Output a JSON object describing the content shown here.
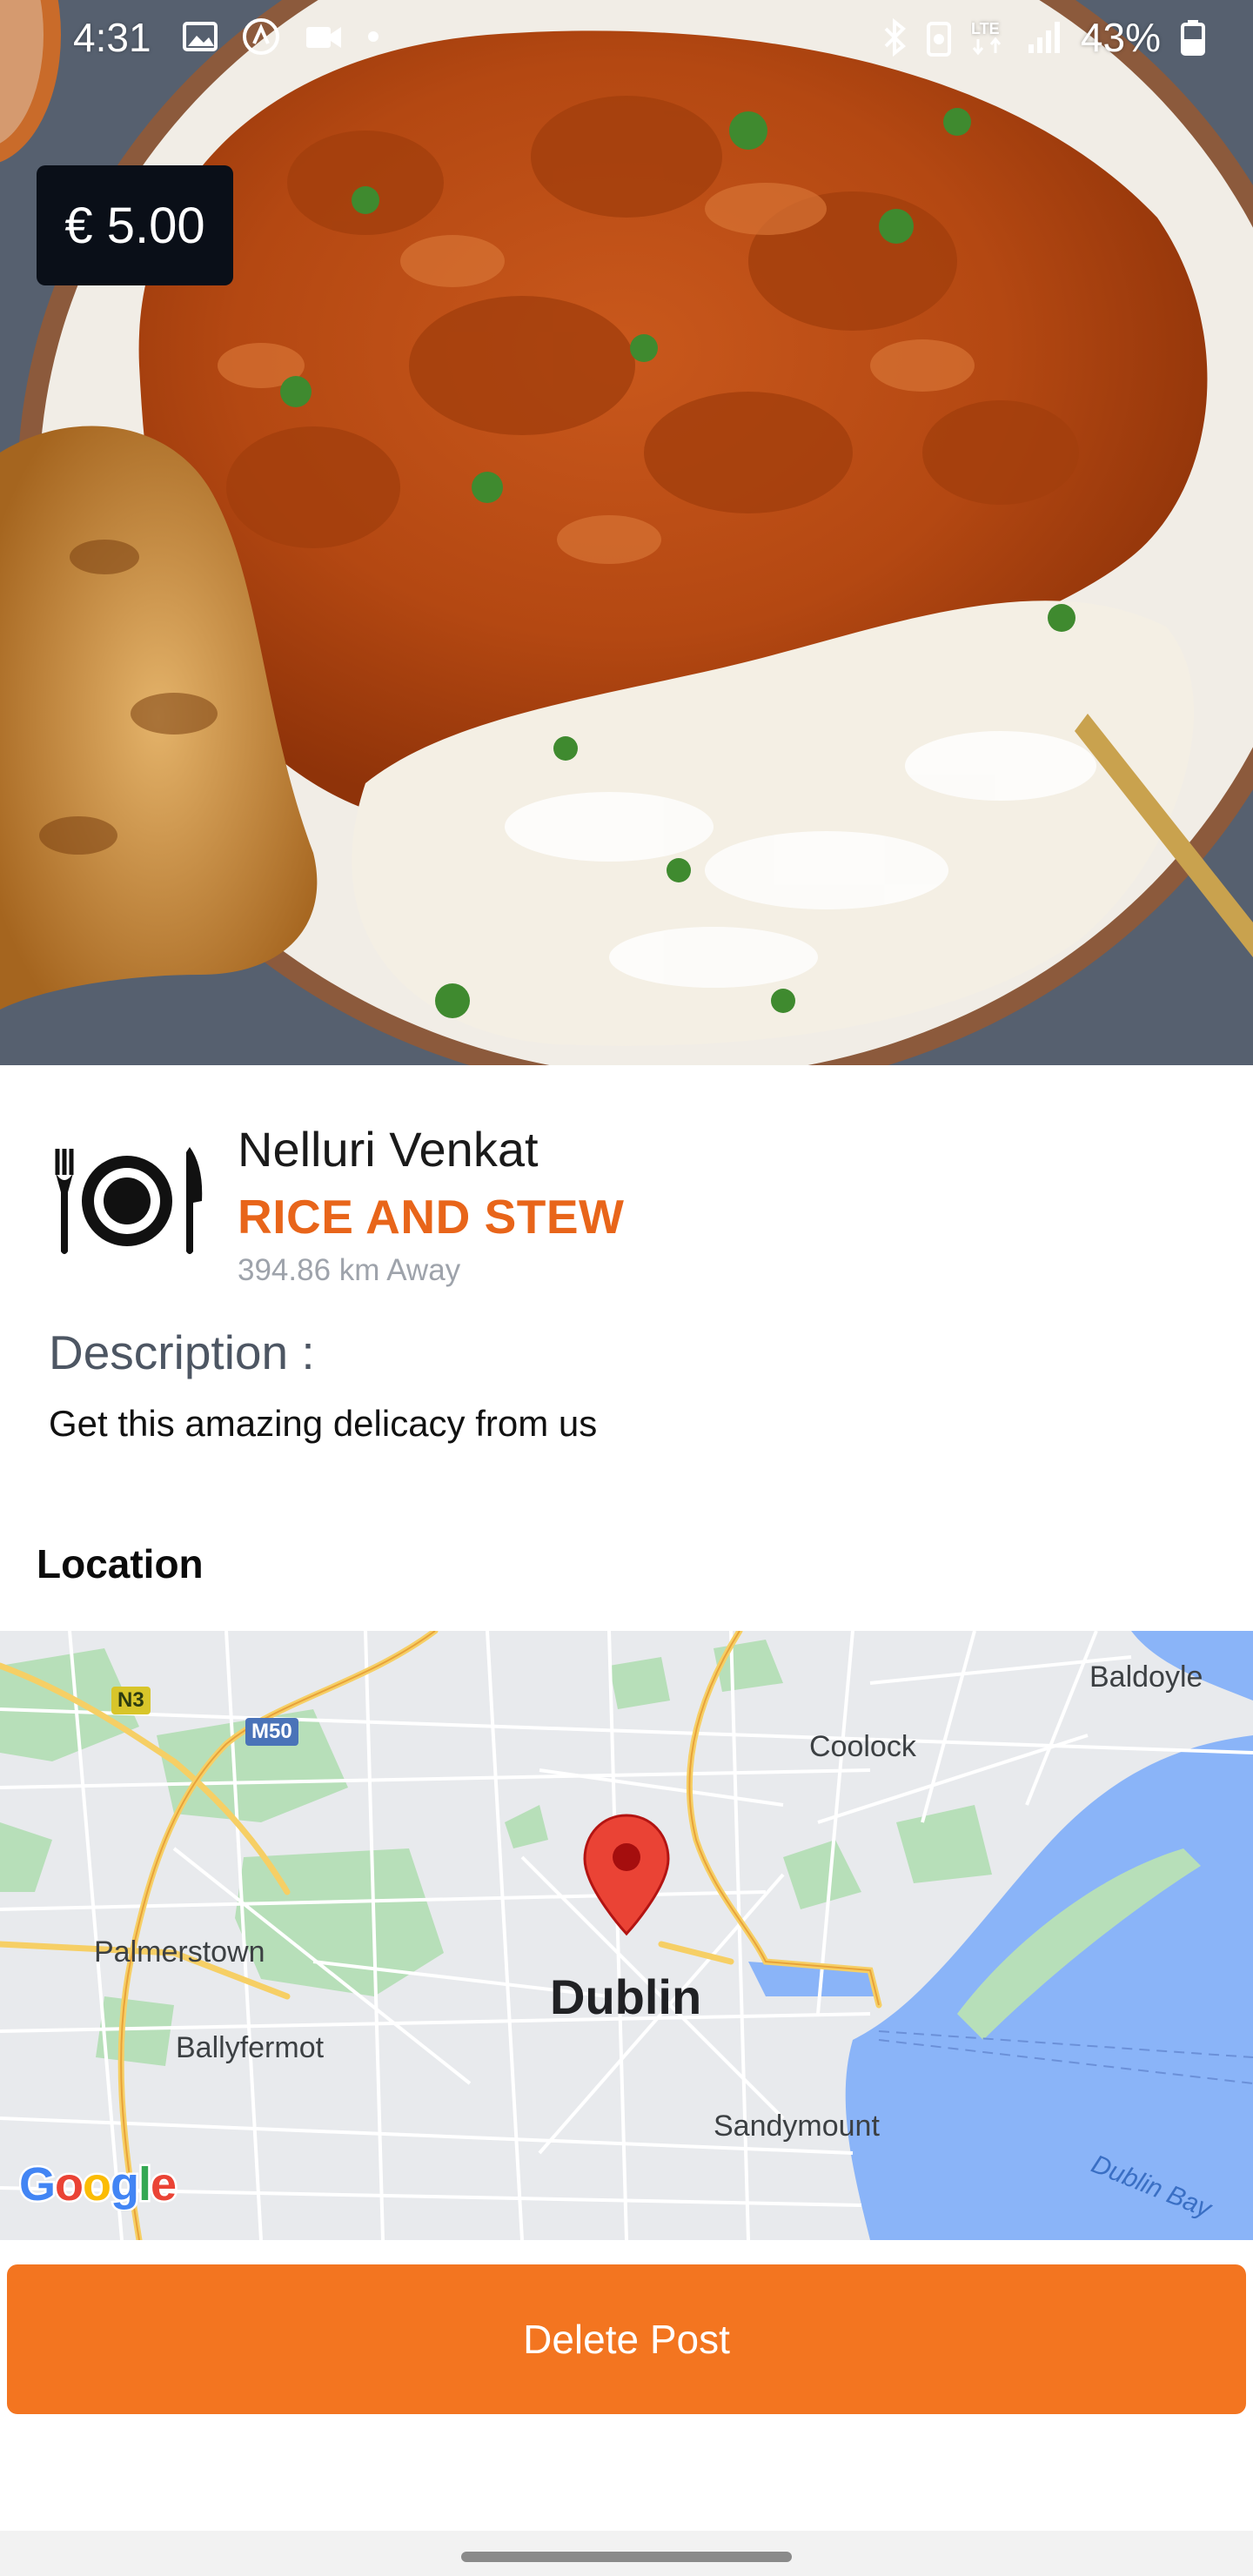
{
  "status_bar": {
    "time": "4:31",
    "battery": "43%",
    "icons": [
      "image-icon",
      "navigation-icon",
      "video-icon",
      "dot-icon",
      "bluetooth-icon",
      "battery-saver-icon",
      "lte-icon",
      "signal-icon",
      "battery-icon"
    ]
  },
  "listing": {
    "price": "€ 5.00",
    "seller_name": "Nelluri Venkat",
    "dish_name": "RICE AND STEW",
    "distance": "394.86 km Away",
    "description_label": "Description :",
    "description": "Get this amazing delicacy from us"
  },
  "location": {
    "heading": "Location",
    "map": {
      "city": "Dublin",
      "places": [
        "Baldoyle",
        "Coolock",
        "Palmerstown",
        "Ballyfermot",
        "Sandymount"
      ],
      "water": "Dublin Bay",
      "roads": [
        "N3",
        "M50"
      ],
      "attribution": "Google"
    }
  },
  "actions": {
    "delete_label": "Delete Post"
  },
  "colors": {
    "accent": "#f37520",
    "dish_title": "#e8651a",
    "price_badge": "#0a0f18",
    "map_water": "#8ab4f8",
    "map_park": "#b7dfb9",
    "marker": "#ea4335"
  }
}
